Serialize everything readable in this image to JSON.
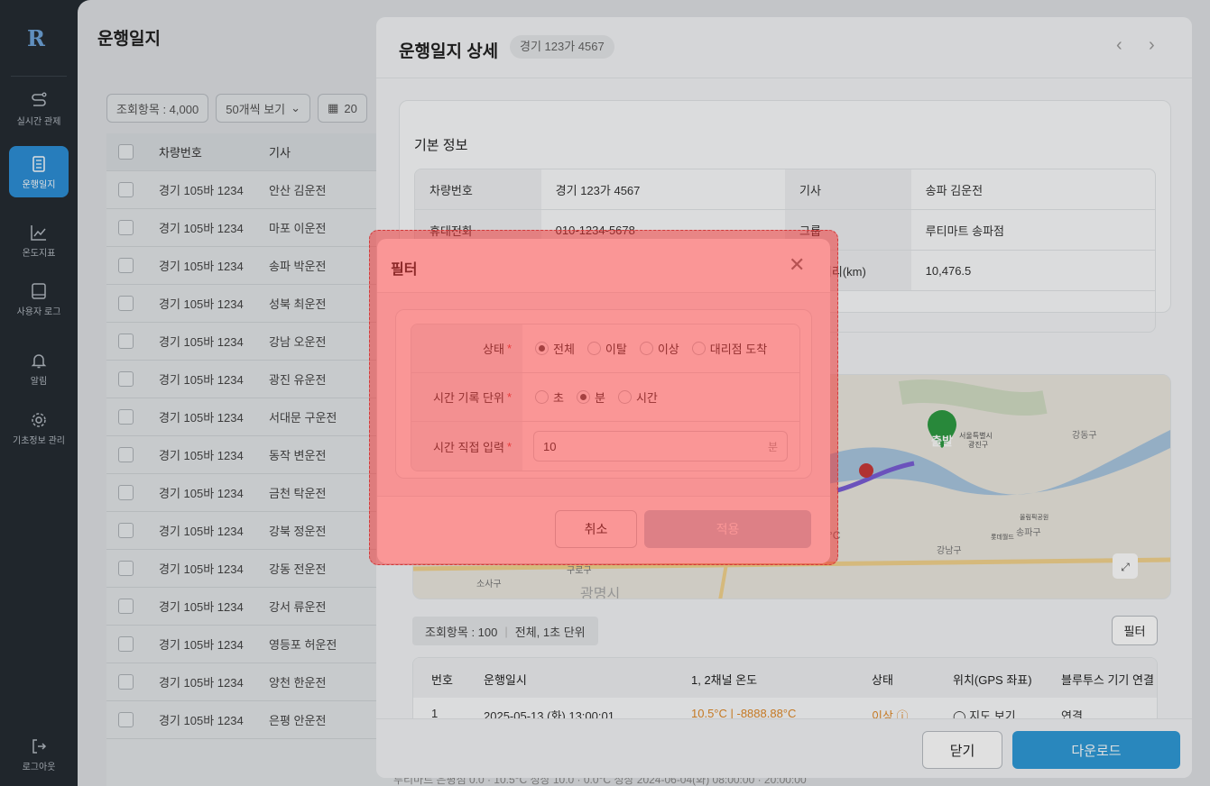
{
  "sidebar": {
    "logo": "R",
    "items": [
      {
        "label": "실시간 관제",
        "icon": "route-icon"
      },
      {
        "label": "운행일지",
        "icon": "logbook-icon"
      },
      {
        "label": "온도지표",
        "icon": "chart-icon"
      },
      {
        "label": "사용자 로그",
        "icon": "tablet-icon"
      },
      {
        "label": "알림",
        "icon": "bell-icon"
      },
      {
        "label": "기초정보 관리",
        "icon": "gear-icon"
      }
    ],
    "logout": "로그아웃"
  },
  "page": {
    "title": "운행일지",
    "count": "조회항목 : 4,000",
    "per_page": "50개씩 보기",
    "date_prefix": "20",
    "columns": [
      "차량번호",
      "기사"
    ],
    "rows": [
      [
        "경기 105바 1234",
        "안산 김운전"
      ],
      [
        "경기 105바 1234",
        "마포 이운전"
      ],
      [
        "경기 105바 1234",
        "송파 박운전"
      ],
      [
        "경기 105바 1234",
        "성북 최운전"
      ],
      [
        "경기 105바 1234",
        "강남 오운전"
      ],
      [
        "경기 105바 1234",
        "광진 유운전"
      ],
      [
        "경기 105바 1234",
        "서대문 구운전"
      ],
      [
        "경기 105바 1234",
        "동작 변운전"
      ],
      [
        "경기 105바 1234",
        "금천 탁운전"
      ],
      [
        "경기 105바 1234",
        "강북 정운전"
      ],
      [
        "경기 105바 1234",
        "강동 전운전"
      ],
      [
        "경기 105바 1234",
        "강서 류운전"
      ],
      [
        "경기 105바 1234",
        "영등포 허운전"
      ],
      [
        "경기 105바 1234",
        "양천 한운전"
      ],
      [
        "경기 105바 1234",
        "은평 안운전"
      ]
    ],
    "cut_row": "루티마트 은평점    0.0 · 10.5°C    정상    10.0 · 0.0°C    정상    2024-06-04(화) 08:00:00 · 20:00:00"
  },
  "drawer": {
    "title": "운행일지 상세",
    "plate": "경기 123가 4567",
    "prev": "‹",
    "next": "›",
    "section": "기본 정보",
    "info": [
      [
        "차량번호",
        "경기 123가 4567",
        "기사",
        "송파 김운전"
      ],
      [
        "휴대전화",
        "010-1234-5678",
        "그룹",
        "루티마트 송파점"
      ],
      [
        "",
        "",
        "누적거리(km)",
        "10,476.5"
      ]
    ],
    "map": {
      "start": "출발",
      "labels": [
        "서울특별시",
        "광진구",
        "강동구",
        "송파구",
        "강남구",
        "구로구",
        "소사구",
        "광명시",
        "올림픽공원",
        "롯데월드"
      ],
      "temp": "°C"
    },
    "count": "조회항목 : 100",
    "count_detail": "전체, 1초 단위",
    "filter_btn": "필터",
    "table_cols": [
      "번호",
      "운행일시",
      "1, 2채널 온도",
      "상태",
      "위치(GPS 좌표)",
      "블루투스 기기 연결"
    ],
    "table_row": [
      "1",
      "2025-05-13 (화) 13:00:01",
      "10.5°C | -8888.88°C",
      "이상 ⓘ",
      "◯ 지도 보기",
      "연결"
    ],
    "close": "닫기",
    "download": "다운로드"
  },
  "modal": {
    "title": "필터",
    "close": "✕",
    "status_label": "상태",
    "status_options": [
      "전체",
      "이탈",
      "이상",
      "대리점 도착"
    ],
    "status_selected": 0,
    "unit_label": "시간 기록 단위",
    "unit_options": [
      "초",
      "분",
      "시간"
    ],
    "unit_selected": 1,
    "input_label": "시간 직접 입력",
    "input_value": "10",
    "input_unit": "분",
    "cancel": "취소",
    "apply": "적용"
  },
  "colors": {
    "accent": "#2f9ad8",
    "sidebar": "#252c33",
    "highlight": "#f52e2e"
  }
}
